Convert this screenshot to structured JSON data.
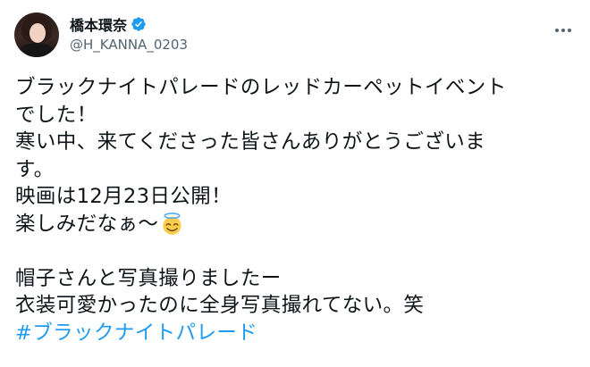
{
  "author": {
    "display_name": "橋本環奈",
    "handle": "@H_KANNA_0203",
    "verified_icon": "verified-badge-icon",
    "avatar_icon": "avatar-photo"
  },
  "menu": {
    "icon": "more-options-icon"
  },
  "tweet": {
    "lines": [
      "ブラックナイトパレードのレッドカーペットイベント",
      "でした！",
      "寒い中、来てくださった皆さんありがとうございま",
      "す。",
      "映画は12月23日公開！",
      "楽しみだなぁ〜"
    ],
    "emoji_icon": "smiling-face-with-halo-emoji",
    "lines2": [
      "帽子さんと写真撮りましたー",
      "衣装可愛かったのに全身写真撮れてない。笑"
    ],
    "hashtag": "#ブラックナイトパレード"
  },
  "colors": {
    "text": "#0f1419",
    "secondary": "#536471",
    "accent": "#1d9bf0"
  }
}
